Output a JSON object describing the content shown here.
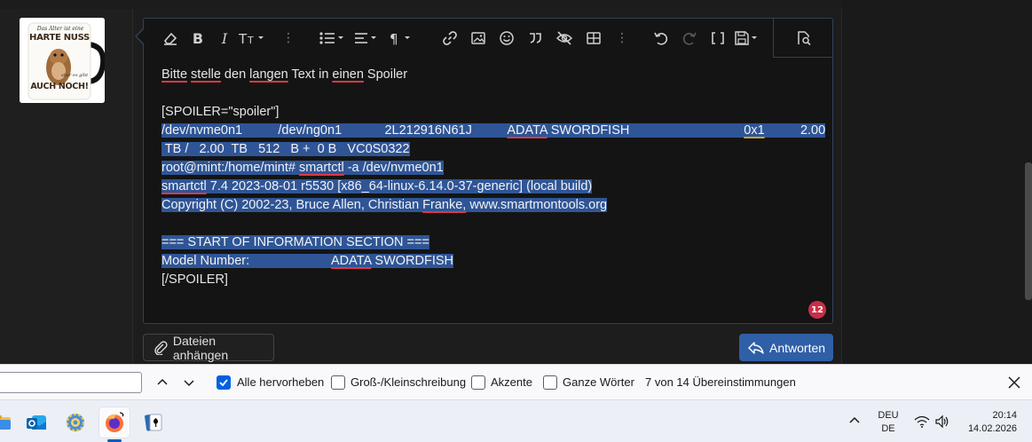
{
  "avatar": {
    "top_text": "Das Alter ist eine",
    "main_text": "HARTE NUSS",
    "sub_text": "aber es gibt",
    "bottom_text": "AUCH NOCH!"
  },
  "editor": {
    "lines": [
      {
        "text": "Bitte stelle den langen Text in einen Spoiler",
        "selected": false
      },
      {
        "text": "",
        "selected": false
      },
      {
        "text": "[SPOILER=\"spoiler\"]",
        "selected": false
      },
      {
        "text": "/dev/nvme0n1          /dev/ng0n1            2L212916N61J          ADATA SWORDFISH                                0x1          2.00",
        "selected": true
      },
      {
        "text": " TB /   2.00  TB   512   B +  0 B   VC0S0322",
        "selected": true
      },
      {
        "text": "root@mint:/home/mint# smartctl -a /dev/nvme0n1",
        "selected": true
      },
      {
        "text": "smartctl 7.4 2023-08-01 r5530 [x86_64-linux-6.14.0-37-generic] (local build)",
        "selected": true
      },
      {
        "text": "Copyright (C) 2002-23, Bruce Allen, Christian Franke, www.smartmontools.org",
        "selected": true
      },
      {
        "text": "",
        "selected": false
      },
      {
        "text": "=== START OF INFORMATION SECTION ===",
        "selected": true
      },
      {
        "text": "Model Number:                       ADATA SWORDFISH",
        "selected": true
      },
      {
        "text": "[/SPOILER]",
        "selected": false
      }
    ],
    "badge_count": "12"
  },
  "buttons": {
    "attach_label": "Dateien anhängen",
    "reply_label": "Antworten"
  },
  "findbar": {
    "search_value": "",
    "highlight_all_label": "Alle hervorheben",
    "highlight_all_checked": true,
    "match_case_label": "Groß-/Kleinschreibung",
    "match_case_checked": false,
    "diacritics_label": "Akzente",
    "diacritics_checked": false,
    "whole_words_label": "Ganze Wörter",
    "whole_words_checked": false,
    "status": "7 von 14 Übereinstimmungen"
  },
  "taskbar": {
    "apps": [
      "explorer-icon",
      "outlook-icon",
      "settings-icon",
      "firefox-icon",
      "solitaire-icon"
    ],
    "language_line1": "DEU",
    "language_line2": "DE",
    "time": "20:14",
    "date": "14.02.2026"
  },
  "colors": {
    "selection": "#2f5596",
    "spell_error": "#d8394a",
    "grammar": "#d4a027",
    "accent": "#2f5fa7",
    "badge": "#c92e47"
  }
}
